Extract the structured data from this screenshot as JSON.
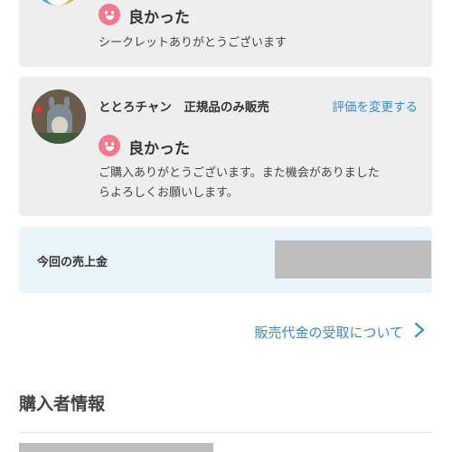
{
  "reviews": [
    {
      "rating_label": "良かった",
      "comment": "シークレットありがとうございます"
    },
    {
      "username": "ととろチャン　正規品のみ販売",
      "change_rating_link": "評価を変更する",
      "rating_label": "良かった",
      "comment_line1": "ご購入ありがとうございます。また機会がありました",
      "comment_line2": "らよろしくお願いします。"
    }
  ],
  "sales": {
    "label": "今回の売上金"
  },
  "payout_link": "販売代金の受取について",
  "buyer_section": {
    "title": "購入者情報"
  },
  "colors": {
    "link": "#3c8bc9",
    "smiley": "#f27a8c",
    "sales_bg": "#e9f5fb",
    "card_bg": "#eeeeee"
  },
  "icons": [
    "smiley-good-icon",
    "chevron-right-icon"
  ]
}
